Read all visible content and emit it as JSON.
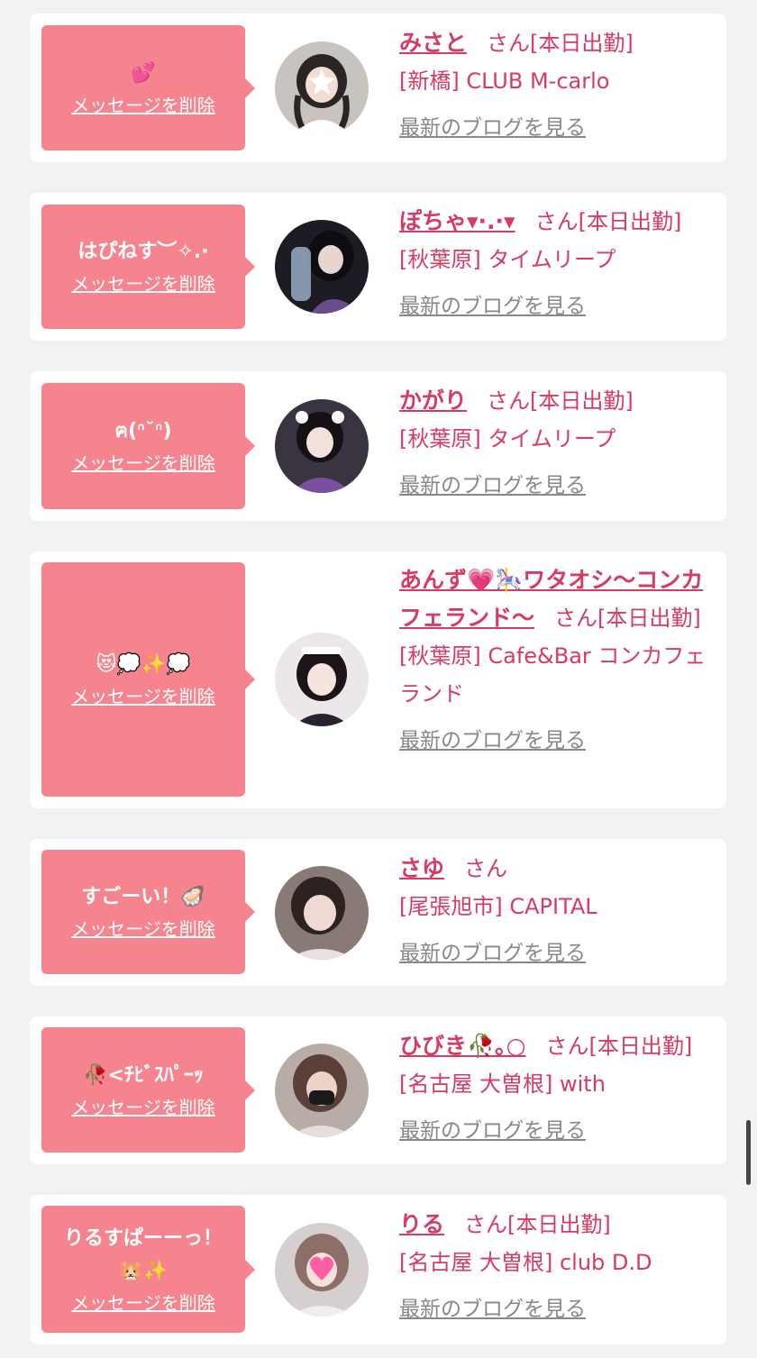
{
  "colors": {
    "background": "#f2f2f2",
    "card": "#ffffff",
    "bubble": "#f5848f",
    "accent_text": "#d63b63",
    "link_gray": "#888888"
  },
  "items": [
    {
      "message": "💕",
      "delete_label": "メッセージを削除",
      "name": "みさと",
      "san": "さん",
      "status": "[本日出勤]",
      "shop": "[新橋] CLUB M-carlo",
      "blog_label": "最新のブログを見る"
    },
    {
      "message": "はぴねす︶✧.·",
      "delete_label": "メッセージを削除",
      "name": "ぽちゃ▾·.·▾",
      "san": "さん",
      "status": "[本日出勤]",
      "shop": "[秋葉原] タイムリープ",
      "blog_label": "最新のブログを見る"
    },
    {
      "message": "ฅ(ᐢ˘ᐢ)",
      "delete_label": "メッセージを削除",
      "name": "かがり",
      "san": "さん",
      "status": "[本日出勤]",
      "shop": "[秋葉原] タイムリープ",
      "blog_label": "最新のブログを見る"
    },
    {
      "message": "😻💭✨💭",
      "delete_label": "メッセージを削除",
      "name": "あんず💗🎠ワタオシ〜コンカフェランド〜",
      "san": "さん",
      "status": "[本日出勤]",
      "shop": "[秋葉原] Cafe&Bar コンカフェランド",
      "blog_label": "最新のブログを見る"
    },
    {
      "message": "すごーい！🦪",
      "delete_label": "メッセージを削除",
      "name": "さゆ",
      "san": "さん",
      "status": "",
      "shop": "[尾張旭市] CAPITAL",
      "blog_label": "最新のブログを見る"
    },
    {
      "message": "🥀<ﾁﾋﾞｽﾊﾟｰｯ",
      "delete_label": "メッセージを削除",
      "name": "ひびき🥀｡○",
      "san": "さん",
      "status": "[本日出勤]",
      "shop": "[名古屋 大曽根] with",
      "blog_label": "最新のブログを見る"
    },
    {
      "message": "りるすぱーーっ！🐹✨",
      "delete_label": "メッセージを削除",
      "name": "りる",
      "san": "さん",
      "status": "[本日出勤]",
      "shop": "[名古屋 大曽根] club D.D",
      "blog_label": "最新のブログを見る"
    }
  ]
}
